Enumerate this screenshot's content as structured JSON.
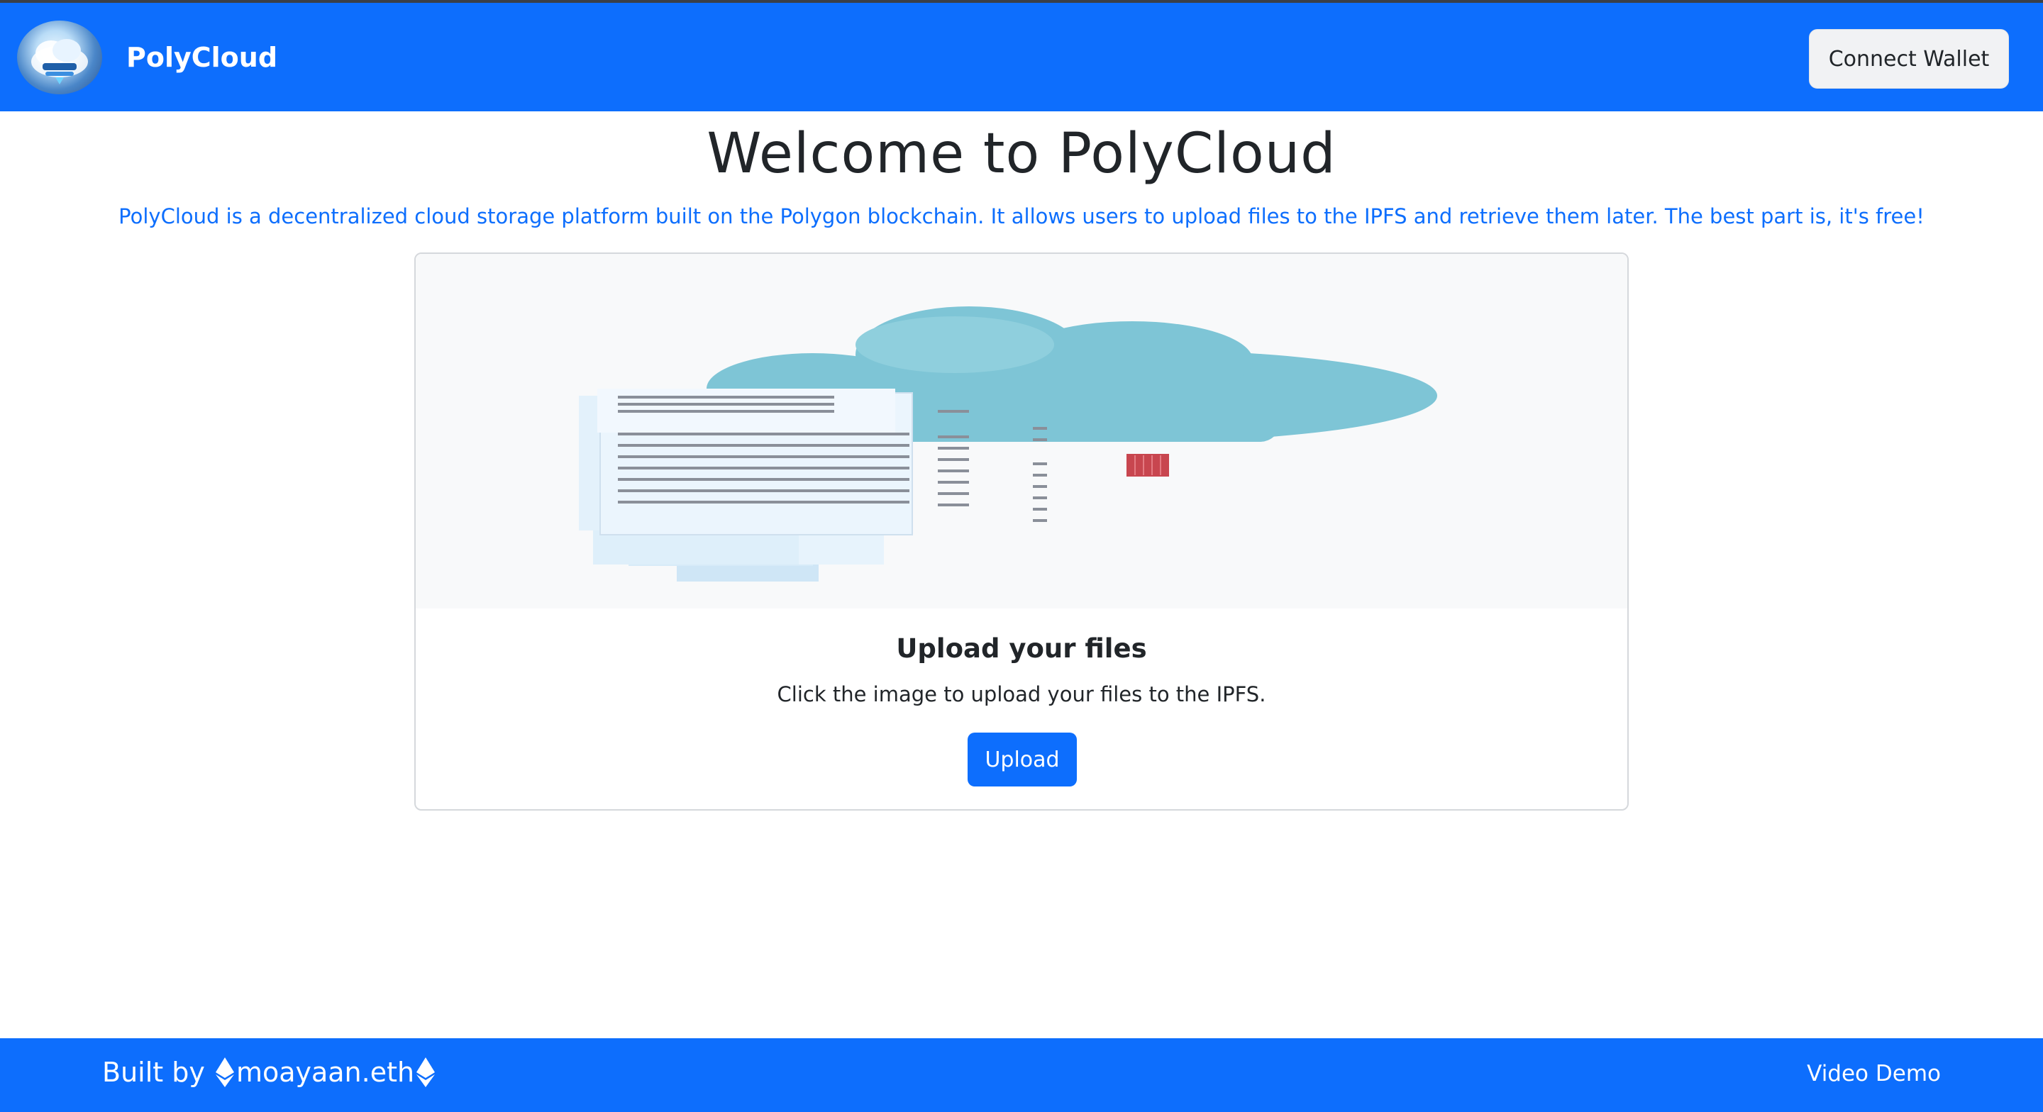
{
  "navbar": {
    "brand_name": "PolyCloud",
    "connect_label": "Connect Wallet"
  },
  "hero": {
    "title": "Welcome to PolyCloud",
    "subtitle": "PolyCloud is a decentralized cloud storage platform built on the Polygon blockchain. It allows users to upload files to the IPFS and retrieve them later. The best part is, it's free!"
  },
  "card": {
    "image_icon": "cloud-files-illustration",
    "title": "Upload your files",
    "text": "Click the image to upload your files to the IPFS.",
    "upload_label": "Upload"
  },
  "footer": {
    "built_by_prefix": "Built by ",
    "author": "moayaan.eth",
    "video_demo": "Video Demo"
  },
  "colors": {
    "primary": "#0d6efd",
    "navbar_border": "#3a3f47",
    "cloud": "#7ec5d6",
    "heading": "#212529"
  }
}
